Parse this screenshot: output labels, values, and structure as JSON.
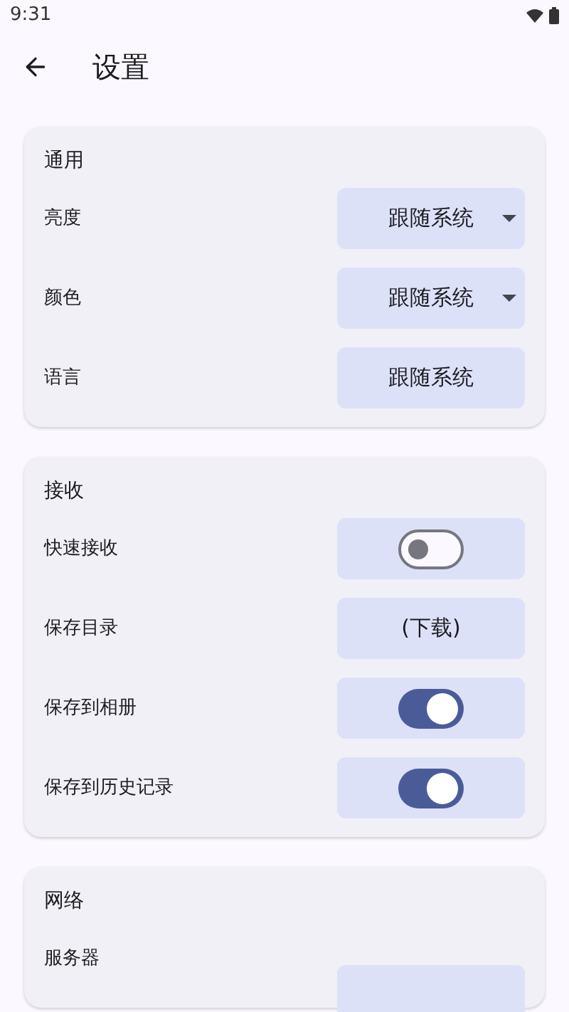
{
  "status_bar": {
    "time": "9:31"
  },
  "header": {
    "title": "设置"
  },
  "sections": [
    {
      "title": "通用",
      "items": [
        {
          "label": "亮度",
          "kind": "dropdown",
          "value": "跟随系统"
        },
        {
          "label": "颜色",
          "kind": "dropdown",
          "value": "跟随系统"
        },
        {
          "label": "语言",
          "kind": "button",
          "value": "跟随系统"
        }
      ]
    },
    {
      "title": "接收",
      "items": [
        {
          "label": "快速接收",
          "kind": "switch",
          "on": false
        },
        {
          "label": "保存目录",
          "kind": "button",
          "value": "(下载)"
        },
        {
          "label": "保存到相册",
          "kind": "switch",
          "on": true
        },
        {
          "label": "保存到历史记录",
          "kind": "switch",
          "on": true
        }
      ]
    },
    {
      "title": "网络",
      "items": [
        {
          "label": "服务器",
          "kind": "partial"
        }
      ]
    }
  ]
}
